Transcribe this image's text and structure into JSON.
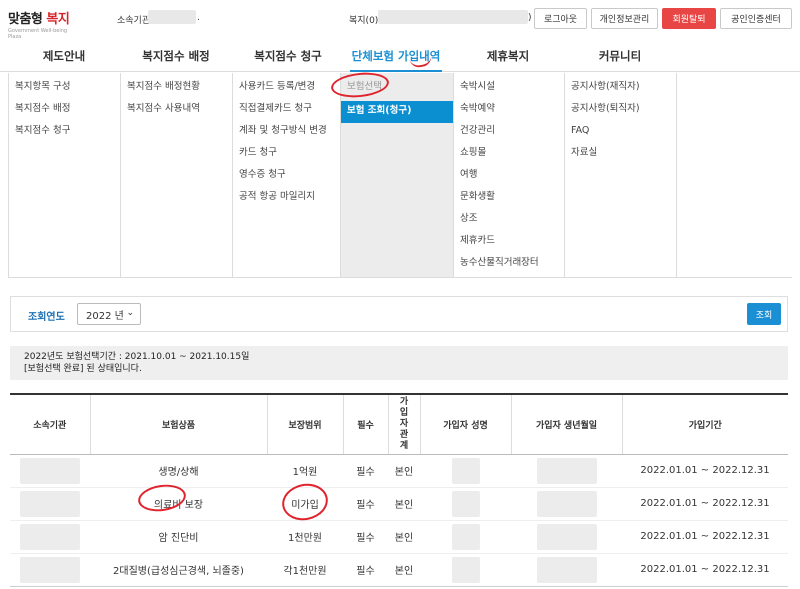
{
  "header": {
    "logo_text_left": "맞춤형",
    "logo_text_right": "복지",
    "logo_subtitle": "Government Well-being Plaza",
    "org_label": "소속기관",
    "org_value_suffix": ".",
    "welfare_label": "복지(0)",
    "welfare_paren": ")",
    "buttons": [
      "로그아웃",
      "개인정보관리",
      "회원탈퇴",
      "공인인증센터"
    ]
  },
  "nav": {
    "items": [
      "제도안내",
      "복지점수 배정",
      "복지점수 청구",
      "단체보험 가입내역",
      "제휴복지",
      "커뮤니티"
    ],
    "active_index": 3
  },
  "mega_menu": {
    "columns": [
      [
        "복지항목 구성",
        "복지점수 배정",
        "복지점수 청구"
      ],
      [
        "복지점수 배정현황",
        "복지점수 사용내역"
      ],
      [
        "사용카드 등록/변경",
        "직접결제카드 청구",
        "계좌 및 청구방식 변경",
        "카드 청구",
        "영수증 청구",
        "공적 항공 마일리지"
      ],
      [
        "보험선택",
        "보험 조회(청구)"
      ],
      [
        "숙박시설",
        "숙박예약",
        "건강관리",
        "쇼핑몰",
        "여행",
        "문화생활",
        "상조",
        "제휴카드",
        "농수산물직거래장터"
      ],
      [
        "공지사항(재직자)",
        "공지사항(퇴직자)",
        "FAQ",
        "자료실"
      ]
    ]
  },
  "search": {
    "label": "조회연도",
    "year_selected": "2022 년",
    "button": "조회"
  },
  "notice": {
    "line1": "2022년도 보험선택기간 : 2021.10.01 ~ 2021.10.15일",
    "line2": "[보험선택 완료] 된 상태입니다."
  },
  "table": {
    "headers": [
      "소속기관",
      "보험상품",
      "보장범위",
      "필수",
      "가입자관계",
      "가입자 성명",
      "가입자 생년월일",
      "가입기간"
    ],
    "rows": [
      {
        "product": "생명/상해",
        "coverage": "1억원",
        "required": "필수",
        "relation": "본인",
        "period": "2022.01.01 ~ 2022.12.31"
      },
      {
        "product": "의료비 보장",
        "coverage": "미가입",
        "required": "필수",
        "relation": "본인",
        "period": "2022.01.01 ~ 2022.12.31"
      },
      {
        "product": "암 진단비",
        "coverage": "1천만원",
        "required": "필수",
        "relation": "본인",
        "period": "2022.01.01 ~ 2022.12.31"
      },
      {
        "product": "2대질병(급성심근경색, 뇌졸중)",
        "coverage": "각1천만원",
        "required": "필수",
        "relation": "본인",
        "period": "2022.01.01 ~ 2022.12.31"
      }
    ]
  },
  "colors": {
    "accent_blue": "#1b8fd3",
    "selected_menu_bg": "#0c8fd1",
    "danger_red": "#e84545",
    "annotation_red": "#e0242e"
  }
}
